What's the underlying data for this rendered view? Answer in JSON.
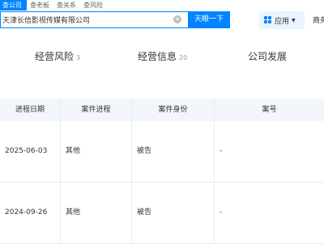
{
  "top_tabs": [
    "查公司",
    "查老板",
    "查关系",
    "查风险"
  ],
  "search": {
    "value": "天津长信影视传媒有限公司",
    "button_label": "天眼一下"
  },
  "header": {
    "apps_label": "应用",
    "biz_label": "商务"
  },
  "nav_tabs": [
    {
      "label": "经营风险",
      "count": "3"
    },
    {
      "label": "经营信息",
      "count": "20"
    },
    {
      "label": "公司发展",
      "count": ""
    }
  ],
  "table": {
    "headers": [
      "进程日期",
      "案件进程",
      "案件身份",
      "案号"
    ],
    "rows": [
      [
        "2025-06-03",
        "其他",
        "被告",
        "-"
      ],
      [
        "2024-09-26",
        "其他",
        "被告",
        "-"
      ]
    ]
  },
  "colors": {
    "accent": "#0084ff",
    "header_bg": "#f2f6fc",
    "apps_bg": "#eaf3ff"
  }
}
